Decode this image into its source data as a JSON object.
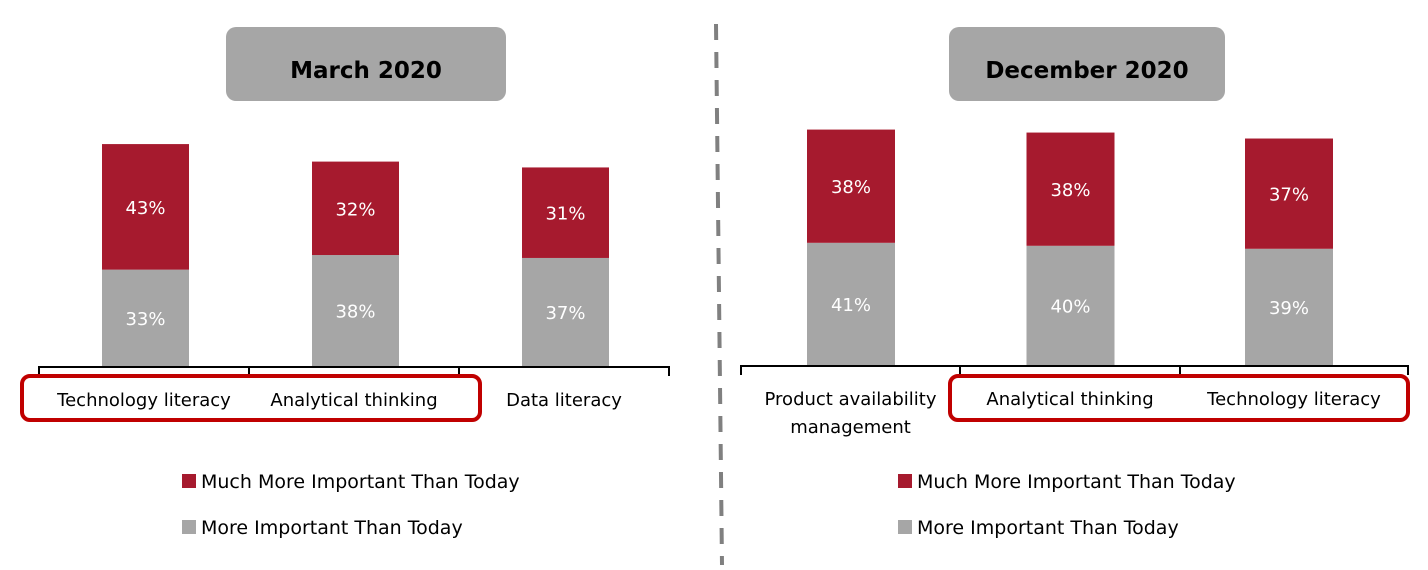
{
  "colors": {
    "much_more": "#A61A2E",
    "more": "#A6A6A6",
    "title_box": "#A6A6A6",
    "highlight": "#C00000",
    "divider": "#808080"
  },
  "chart_data": [
    {
      "type": "bar",
      "stacked": true,
      "title": "March 2020",
      "categories": [
        "Technology literacy",
        "Analytical thinking",
        "Data literacy"
      ],
      "category_lines": [
        [
          "Technology literacy"
        ],
        [
          "Analytical thinking"
        ],
        [
          "Data literacy"
        ]
      ],
      "series": [
        {
          "name": "More Important Than Today",
          "values": [
            33,
            38,
            37
          ]
        },
        {
          "name": "Much More Important Than Today",
          "values": [
            43,
            32,
            31
          ]
        }
      ],
      "value_format": "percent",
      "highlighted_categories": [
        "Technology literacy",
        "Analytical thinking"
      ],
      "legend": [
        "Much More Important Than Today",
        "More Important Than Today"
      ],
      "legend_position": "bottom",
      "xlabel": "",
      "ylabel": "",
      "ylim": [
        0,
        80
      ],
      "grid": false
    },
    {
      "type": "bar",
      "stacked": true,
      "title": "December 2020",
      "categories": [
        "Product availability management",
        "Analytical thinking",
        "Technology literacy"
      ],
      "category_lines": [
        [
          "Product availability",
          "management"
        ],
        [
          "Analytical thinking"
        ],
        [
          "Technology literacy"
        ]
      ],
      "series": [
        {
          "name": "More Important Than Today",
          "values": [
            41,
            40,
            39
          ]
        },
        {
          "name": "Much More Important Than Today",
          "values": [
            38,
            38,
            37
          ]
        }
      ],
      "value_format": "percent",
      "highlighted_categories": [
        "Analytical thinking",
        "Technology literacy"
      ],
      "legend": [
        "Much More Important Than Today",
        "More Important Than Today"
      ],
      "legend_position": "bottom",
      "xlabel": "",
      "ylabel": "",
      "ylim": [
        0,
        80
      ],
      "grid": false
    }
  ]
}
